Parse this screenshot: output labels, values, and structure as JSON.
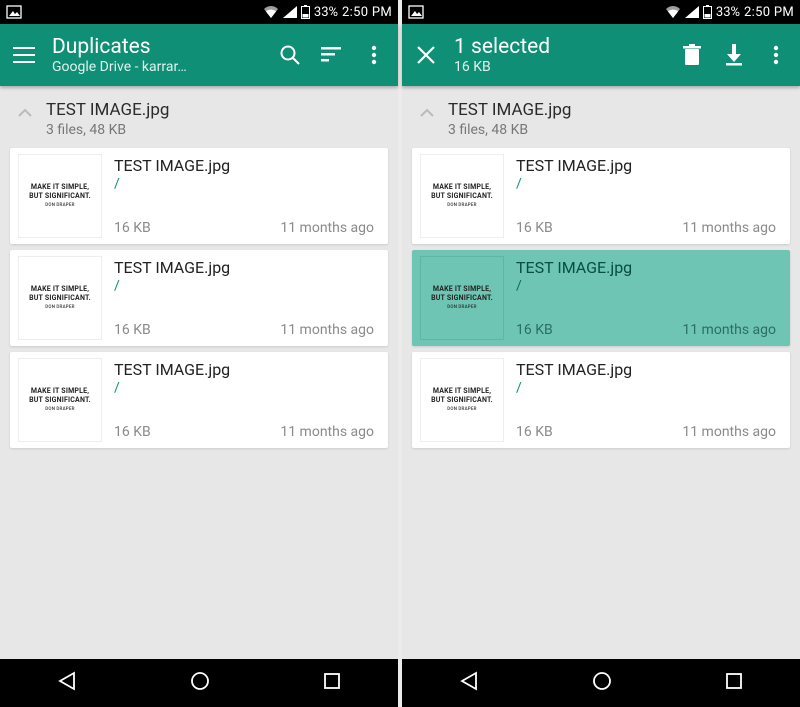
{
  "status": {
    "battery_pct": "33%",
    "time": "2:50 PM"
  },
  "left": {
    "title": "Duplicates",
    "subtitle": "Google Drive - karrar…",
    "group": {
      "title": "TEST IMAGE.jpg",
      "summary": "3 files, 48 KB"
    },
    "thumb": {
      "l1": "MAKE IT SIMPLE,",
      "l2": "BUT SIGNIFICANT.",
      "l3": "DON DRAPER"
    },
    "items": [
      {
        "name": "TEST IMAGE.jpg",
        "path": "/",
        "size": "16 KB",
        "age": "11 months ago",
        "selected": false
      },
      {
        "name": "TEST IMAGE.jpg",
        "path": "/",
        "size": "16 KB",
        "age": "11 months ago",
        "selected": false
      },
      {
        "name": "TEST IMAGE.jpg",
        "path": "/",
        "size": "16 KB",
        "age": "11 months ago",
        "selected": false
      }
    ]
  },
  "right": {
    "title": "1 selected",
    "subtitle": "16 KB",
    "group": {
      "title": "TEST IMAGE.jpg",
      "summary": "3 files, 48 KB"
    },
    "thumb": {
      "l1": "MAKE IT SIMPLE,",
      "l2": "BUT SIGNIFICANT.",
      "l3": "DON DRAPER"
    },
    "items": [
      {
        "name": "TEST IMAGE.jpg",
        "path": "/",
        "size": "16 KB",
        "age": "11 months ago",
        "selected": false
      },
      {
        "name": "TEST IMAGE.jpg",
        "path": "/",
        "size": "16 KB",
        "age": "11 months ago",
        "selected": true
      },
      {
        "name": "TEST IMAGE.jpg",
        "path": "/",
        "size": "16 KB",
        "age": "11 months ago",
        "selected": false
      }
    ]
  }
}
